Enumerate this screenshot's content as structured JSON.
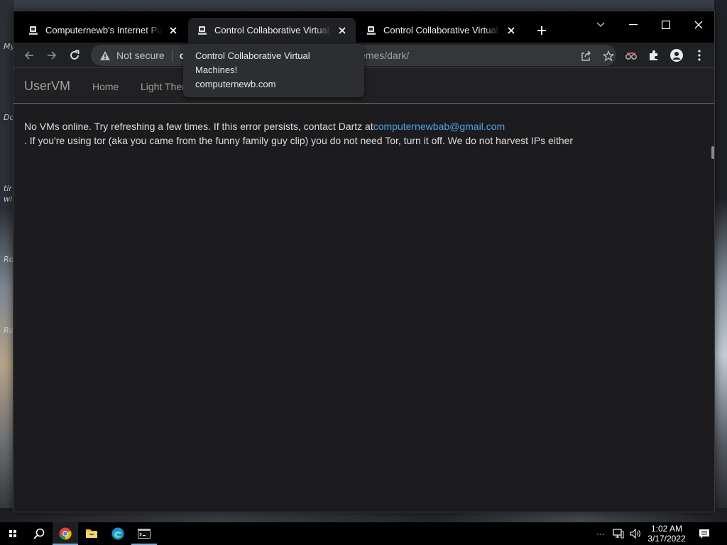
{
  "desktop": {
    "icon_labels": [
      "My",
      "Do",
      "tir",
      "wi",
      "Ro",
      "Ro"
    ]
  },
  "browser": {
    "tabs": [
      {
        "title": "Computernewb's Internet Pub Hub",
        "active": false
      },
      {
        "title": "Control Collaborative Virtual Machines!",
        "active": true
      },
      {
        "title": "Control Collaborative Virtual Machines!",
        "active": false
      }
    ],
    "tooltip": {
      "title": "Control Collaborative Virtual Machines!",
      "host": "computernewb.com"
    },
    "omnibox": {
      "security_label": "Not secure",
      "host_fragment": "co",
      "path_fragment": "emes/dark/"
    }
  },
  "page": {
    "brand": "UserVM",
    "nav": [
      {
        "label": "Home"
      },
      {
        "label": "Light Theme"
      }
    ],
    "message_part1": "No VMs online. Try refreshing a few times. If this error persists, contact Dartz at",
    "message_email": "computernewbab@gmail.com",
    "message_line2": ". If you're using tor (aka you came from the funny family guy clip) you do not need Tor, turn it off. We do not harvest IPs either"
  },
  "taskbar": {
    "time": "1:02 AM",
    "date": "3/17/2022",
    "overflow_label": "···",
    "apps": [
      "chrome-icon",
      "file-explorer-icon",
      "edge-icon",
      "terminal-icon"
    ]
  },
  "colors": {
    "link": "#4fa3e0",
    "page_bg": "#1c1c1e",
    "navbar_bg": "#212123"
  }
}
